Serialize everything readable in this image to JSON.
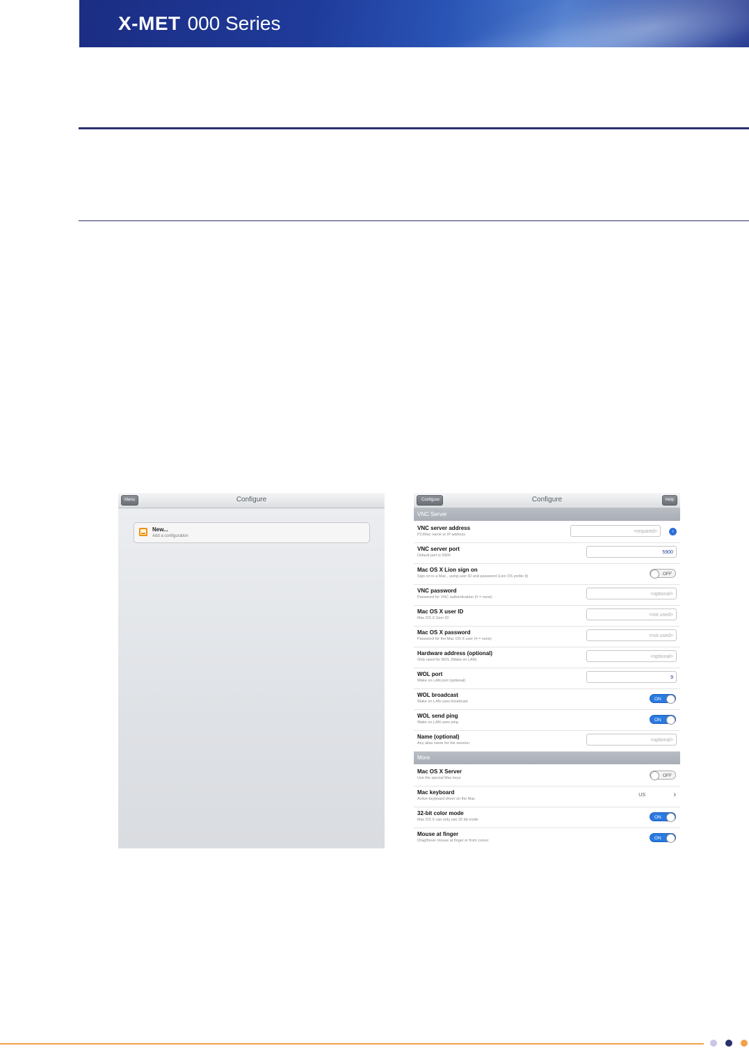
{
  "header": {
    "brand_bold": "X-MET",
    "brand_series": "000 Series"
  },
  "left_screen": {
    "nav_title": "Configure",
    "menu_button": "Menu",
    "new_item": {
      "title": "New...",
      "subtitle": "Add a configuration"
    }
  },
  "right_screen": {
    "nav_title": "Configure",
    "back_button": "Configure",
    "help_button": "Help",
    "section_vnc": "VNC Server",
    "section_more": "More",
    "rows": [
      {
        "label": "VNC server address",
        "sub": "PC/Mac name or IP address",
        "kind": "field",
        "placeholder": "<required>",
        "value": ""
      },
      {
        "label": "VNC server port",
        "sub": "Default port is 5900",
        "kind": "field",
        "placeholder": "",
        "value": "5900"
      },
      {
        "label": "Mac OS X Lion sign on",
        "sub": "Sign on to a Mac , using user ID and password (Lion OS prefer it)",
        "kind": "toggle",
        "state": "OFF"
      },
      {
        "label": "VNC password",
        "sub": "Password for VNC authentication (# = none)",
        "kind": "field",
        "placeholder": "<optional>",
        "value": ""
      },
      {
        "label": "Mac OS X user ID",
        "sub": "Mac OS X User ID",
        "kind": "field",
        "placeholder": "<not used>",
        "value": ""
      },
      {
        "label": "Mac OS X password",
        "sub": "Password for the Mac OS X user (# = none)",
        "kind": "field",
        "placeholder": "<not used>",
        "value": ""
      },
      {
        "label": "Hardware address (optional)",
        "sub": "Only used for WOL (Wake on LAN)",
        "kind": "field",
        "placeholder": "<optional>",
        "value": ""
      },
      {
        "label": "WOL port",
        "sub": "Wake on LAN port (optional)",
        "kind": "field",
        "placeholder": "",
        "value": "9"
      },
      {
        "label": "WOL broadcast",
        "sub": "Wake on LAN uses broadcast",
        "kind": "toggle",
        "state": "ON"
      },
      {
        "label": "WOL send ping",
        "sub": "Wake on LAN uses ping",
        "kind": "toggle",
        "state": "ON"
      },
      {
        "label": "Name (optional)",
        "sub": "Any alias name for the session",
        "kind": "field",
        "placeholder": "<optional>",
        "value": ""
      }
    ],
    "more_rows": [
      {
        "label": "Mac OS X Server",
        "sub": "Use the special Mac keys",
        "kind": "toggle",
        "state": "OFF"
      },
      {
        "label": "Mac keyboard",
        "sub": "Active keyboard driver on the Mac",
        "kind": "select",
        "value": "US"
      },
      {
        "label": "32-bit color mode",
        "sub": "Mac OS X can only use 32 bit mode",
        "kind": "toggle",
        "state": "ON"
      },
      {
        "label": "Mouse at finger",
        "sub": "Drag/hover mouse at finger or from cursor",
        "kind": "toggle",
        "state": "ON"
      }
    ]
  },
  "colors": {
    "banner": "#1f3b9a",
    "rule": "#2a2f6e",
    "footer": "#f2a14b",
    "toggle_on": "#2a7ae0"
  }
}
